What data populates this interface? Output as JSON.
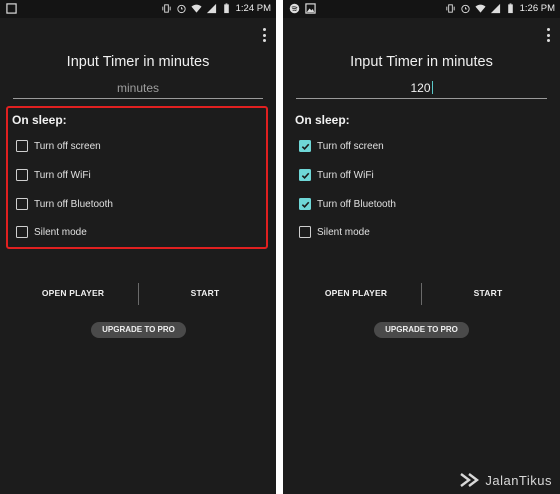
{
  "screens": [
    {
      "status_bar": {
        "time": "1:24 PM",
        "battery": "100"
      },
      "title": "Input Timer in minutes",
      "input": {
        "value": "",
        "placeholder": "minutes"
      },
      "section_label": "On sleep:",
      "options": [
        {
          "label": "Turn off screen",
          "checked": false
        },
        {
          "label": "Turn off WiFi",
          "checked": false
        },
        {
          "label": "Turn off Bluetooth",
          "checked": false
        },
        {
          "label": "Silent mode",
          "checked": false
        }
      ],
      "buttons": {
        "open_player": "OPEN PLAYER",
        "start": "START",
        "upgrade": "UPGRADE TO PRO"
      }
    },
    {
      "status_bar": {
        "time": "1:26 PM",
        "battery": "100"
      },
      "title": "Input Timer in minutes",
      "input": {
        "value": "120",
        "placeholder": "minutes"
      },
      "section_label": "On sleep:",
      "options": [
        {
          "label": "Turn off screen",
          "checked": true
        },
        {
          "label": "Turn off WiFi",
          "checked": true
        },
        {
          "label": "Turn off Bluetooth",
          "checked": true
        },
        {
          "label": "Silent mode",
          "checked": false
        }
      ],
      "buttons": {
        "open_player": "OPEN PLAYER",
        "start": "START",
        "upgrade": "UPGRADE TO PRO"
      }
    }
  ],
  "watermark": "JalanTikus",
  "colors": {
    "background": "#1c1c1c",
    "accent": "#6fd7d7",
    "highlight": "#e02020"
  }
}
